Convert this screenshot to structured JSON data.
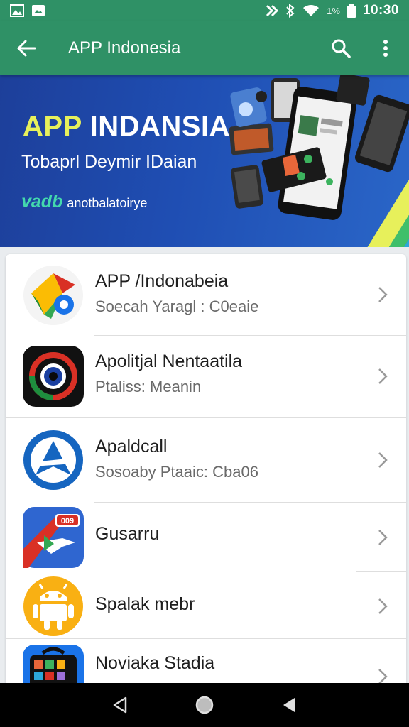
{
  "status_bar": {
    "time": "10:30",
    "battery_percent": "1%",
    "left_icons": [
      "gallery-icon",
      "image-icon"
    ],
    "right_icons": [
      "nfc-icon",
      "bluetooth-icon",
      "wifi-icon",
      "battery-icon"
    ]
  },
  "app_bar": {
    "title": "APP Indonesia",
    "color": "#2f9166"
  },
  "banner": {
    "title_highlight": "APP",
    "title_rest": " INDANSIA",
    "subtitle": "Tobaprl Deymir IDaian",
    "brand": "vadb",
    "tagline": "anotbalatoirye"
  },
  "list": {
    "items": [
      {
        "title": "APP /Indonabeia",
        "subtitle": "Soecah Yaragl : C0eaie",
        "icon": "google-maps-like-icon"
      },
      {
        "title": "Apolitjal Nentaatila",
        "subtitle": "Ptaliss: Meanin",
        "icon": "target-ring-icon"
      },
      {
        "title": "Apaldcall",
        "subtitle": "Sosoaby Ptaaic: Cba06",
        "icon": "compass-a-icon"
      },
      {
        "title": "Gusarru",
        "subtitle": "",
        "icon": "map-plane-icon",
        "badge": "009"
      },
      {
        "title": "Spalak mebr",
        "subtitle": "",
        "icon": "android-robot-icon"
      },
      {
        "title": "Noviaka Stadia",
        "subtitle": "",
        "icon": "media-bag-icon"
      }
    ]
  },
  "nav_bar": {
    "buttons": [
      "back-triangle-icon",
      "home-circle-icon",
      "recents-icon"
    ]
  }
}
